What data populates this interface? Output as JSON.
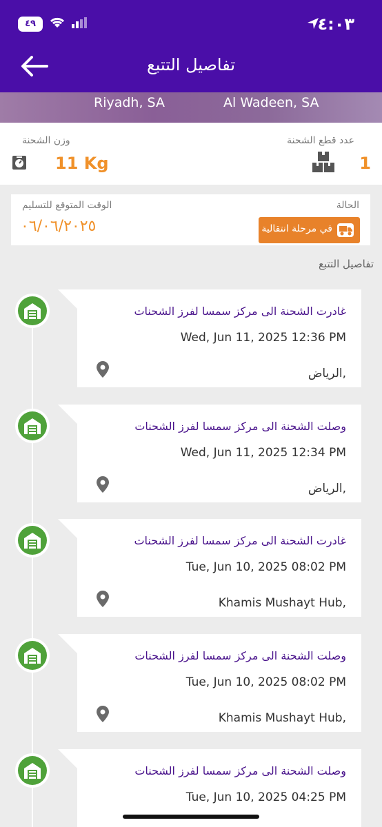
{
  "status_bar": {
    "battery": "٤٩",
    "time": "٤:٠٣"
  },
  "header": {
    "title": "تفاصيل التتبع"
  },
  "route": {
    "from": "Riyadh, SA",
    "to": "Al Wadeen, SA"
  },
  "info": {
    "weight_label": "وزن الشحنة",
    "weight_value": "11 Kg",
    "count_label": "عدد قطع الشحنة",
    "count_value": "1"
  },
  "status": {
    "eta_label": "الوقت المتوقع للتسليم",
    "eta_value": "٠٦/٠٦/٢٠٢٥",
    "state_label": "الحالة",
    "state_value": "في مرحلة انتقالية"
  },
  "section_title": "تفاصيل التتبع",
  "timeline": [
    {
      "title": "غادرت الشحنة الى مركز سمسا لفرز الشحنات",
      "date": "Wed, Jun 11, 2025 12:36 PM",
      "place": "الرياض,"
    },
    {
      "title": "وصلت الشحنة الى مركز سمسا لفرز الشحنات",
      "date": "Wed, Jun 11, 2025 12:34 PM",
      "place": "الرياض,"
    },
    {
      "title": "غادرت الشحنة الى مركز سمسا لفرز الشحنات",
      "date": "Tue, Jun 10, 2025 08:02 PM",
      "place": "Khamis Mushayt Hub,"
    },
    {
      "title": "وصلت الشحنة الى مركز سمسا لفرز الشحنات",
      "date": "Tue, Jun 10, 2025 08:02 PM",
      "place": "Khamis Mushayt Hub,"
    },
    {
      "title": "وصلت الشحنة الى مركز سمسا لفرز الشحنات",
      "date": "Tue, Jun 10, 2025 04:25 PM",
      "place": ""
    }
  ],
  "colors": {
    "header": "#4a0ea8",
    "accent": "#f0912a",
    "badge": "#e8822a",
    "marker": "#4fa23a"
  },
  "icons": [
    "back-arrow-icon",
    "scale-icon",
    "boxes-icon",
    "truck-icon",
    "warehouse-icon",
    "location-pin-icon"
  ]
}
